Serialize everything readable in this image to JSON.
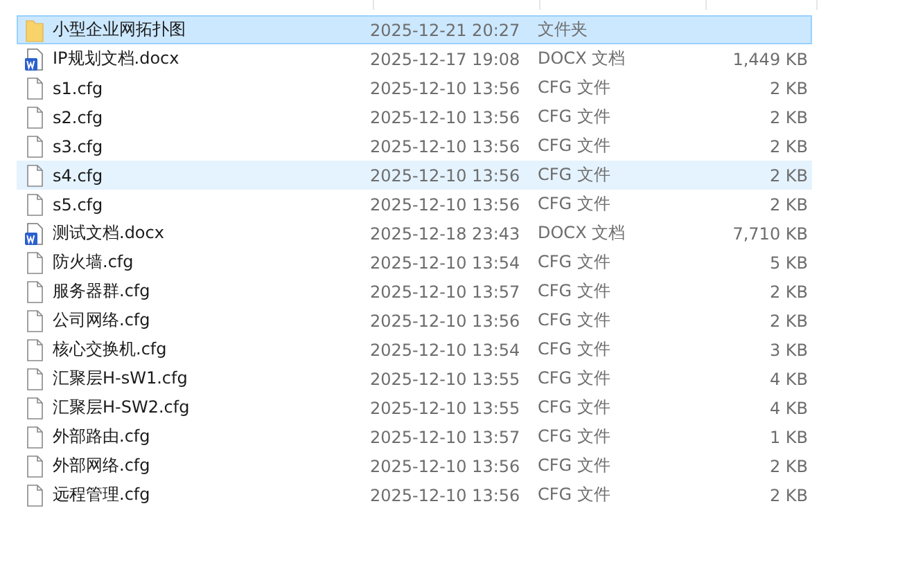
{
  "files": [
    {
      "name": "小型企业网拓扑图",
      "modified": "2025-12-21 20:27",
      "type": "文件夹",
      "kind": "folder",
      "selected": true,
      "hovered": false
    },
    {
      "name": "IP规划文档.docx",
      "modified": "2025-12-17 19:08",
      "type": "DOCX 文档",
      "size": "1,449 KB",
      "kind": "docx",
      "selected": false,
      "hovered": false
    },
    {
      "name": "s1.cfg",
      "modified": "2025-12-10 13:56",
      "type": "CFG 文件",
      "size": "2 KB",
      "kind": "file",
      "selected": false,
      "hovered": false
    },
    {
      "name": "s2.cfg",
      "modified": "2025-12-10 13:56",
      "type": "CFG 文件",
      "size": "2 KB",
      "kind": "file",
      "selected": false,
      "hovered": false
    },
    {
      "name": "s3.cfg",
      "modified": "2025-12-10 13:56",
      "type": "CFG 文件",
      "size": "2 KB",
      "kind": "file",
      "selected": false,
      "hovered": false
    },
    {
      "name": "s4.cfg",
      "modified": "2025-12-10 13:56",
      "type": "CFG 文件",
      "size": "2 KB",
      "kind": "file",
      "selected": false,
      "hovered": true
    },
    {
      "name": "s5.cfg",
      "modified": "2025-12-10 13:56",
      "type": "CFG 文件",
      "size": "2 KB",
      "kind": "file",
      "selected": false,
      "hovered": false
    },
    {
      "name": "测试文档.docx",
      "modified": "2025-12-18 23:43",
      "type": "DOCX 文档",
      "size": "7,710 KB",
      "kind": "docx",
      "selected": false,
      "hovered": false
    },
    {
      "name": "防火墙.cfg",
      "modified": "2025-12-10 13:54",
      "type": "CFG 文件",
      "size": "5 KB",
      "kind": "file",
      "selected": false,
      "hovered": false
    },
    {
      "name": "服务器群.cfg",
      "modified": "2025-12-10 13:57",
      "type": "CFG 文件",
      "size": "2 KB",
      "kind": "file",
      "selected": false,
      "hovered": false
    },
    {
      "name": "公司网络.cfg",
      "modified": "2025-12-10 13:56",
      "type": "CFG 文件",
      "size": "2 KB",
      "kind": "file",
      "selected": false,
      "hovered": false
    },
    {
      "name": "核心交换机.cfg",
      "modified": "2025-12-10 13:54",
      "type": "CFG 文件",
      "size": "3 KB",
      "kind": "file",
      "selected": false,
      "hovered": false
    },
    {
      "name": "汇聚层H-sW1.cfg",
      "modified": "2025-12-10 13:55",
      "type": "CFG 文件",
      "size": "4 KB",
      "kind": "file",
      "selected": false,
      "hovered": false
    },
    {
      "name": "汇聚层H-SW2.cfg",
      "modified": "2025-12-10 13:55",
      "type": "CFG 文件",
      "size": "4 KB",
      "kind": "file",
      "selected": false,
      "hovered": false
    },
    {
      "name": "外部路由.cfg",
      "modified": "2025-12-10 13:57",
      "type": "CFG 文件",
      "size": "1 KB",
      "kind": "file",
      "selected": false,
      "hovered": false
    },
    {
      "name": "外部网络.cfg",
      "modified": "2025-12-10 13:56",
      "type": "CFG 文件",
      "size": "2 KB",
      "kind": "file",
      "selected": false,
      "hovered": false
    },
    {
      "name": "远程管理.cfg",
      "modified": "2025-12-10 13:56",
      "type": "CFG 文件",
      "size": "2 KB",
      "kind": "file",
      "selected": false,
      "hovered": false
    }
  ]
}
